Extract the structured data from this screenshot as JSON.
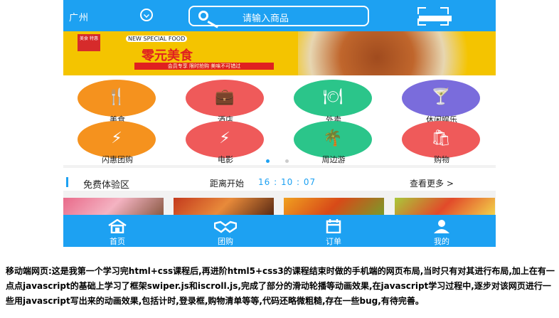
{
  "header": {
    "city": "广州",
    "search_placeholder": "请输入商品"
  },
  "banner": {
    "tag": "美食 特惠",
    "brand": "NEW SPECIAL FOOD",
    "title": "零元美食",
    "subtitle": "会员专享 限时抢购 美味不可错过"
  },
  "categories": [
    {
      "label": "美食",
      "color": "#f5921e",
      "icon": "fork-knife-icon",
      "glyph": "🍴"
    },
    {
      "label": "酒店",
      "color": "#ef5a5a",
      "icon": "briefcase-icon",
      "glyph": "💼"
    },
    {
      "label": "外卖",
      "color": "#2bc58a",
      "icon": "cloche-icon",
      "glyph": "🍽"
    },
    {
      "label": "休闲娱乐",
      "color": "#7a6cdc",
      "icon": "cocktail-icon",
      "glyph": "🍸"
    },
    {
      "label": "闪惠团购",
      "color": "#f5921e",
      "icon": "flash-tag-icon",
      "glyph": "⚡"
    },
    {
      "label": "电影",
      "color": "#ef5a5a",
      "icon": "movie-icon",
      "glyph": "⚡"
    },
    {
      "label": "周边游",
      "color": "#2bc58a",
      "icon": "palm-tree-icon",
      "glyph": "🌴"
    },
    {
      "label": "购物",
      "color": "#ef5a5a",
      "icon": "shopping-bag-icon",
      "glyph": "🛍"
    }
  ],
  "carousel": {
    "total": 2,
    "active": 1
  },
  "section": {
    "title": "免费体验区",
    "countdown_label": "距离开始",
    "countdown": "16 : 10 : 07",
    "more": "查看更多 >"
  },
  "tabbar": [
    {
      "label": "首页",
      "icon": "home-icon"
    },
    {
      "label": "团购",
      "icon": "handshake-icon"
    },
    {
      "label": "订单",
      "icon": "calendar-icon"
    },
    {
      "label": "我的",
      "icon": "user-icon"
    }
  ],
  "description": "移动端网页:这是我第一个学习完html+css课程后,再进阶html5+css3的课程结束时做的手机端的网页布局,当时只有对其进行布局,加上在有一点点javascript的基础上学习了框架swiper.js和iscroll.js,完成了部分的滑动轮播等动画效果,在javascript学习过程中,逐步对该网页进行一些用javascript写出来的动画效果,包括计时,登录框,购物清单等等,代码还略微粗糙,存在一些bug,有待完善。",
  "colors": {
    "accent": "#1da1f2",
    "banner": "#f4c400"
  }
}
